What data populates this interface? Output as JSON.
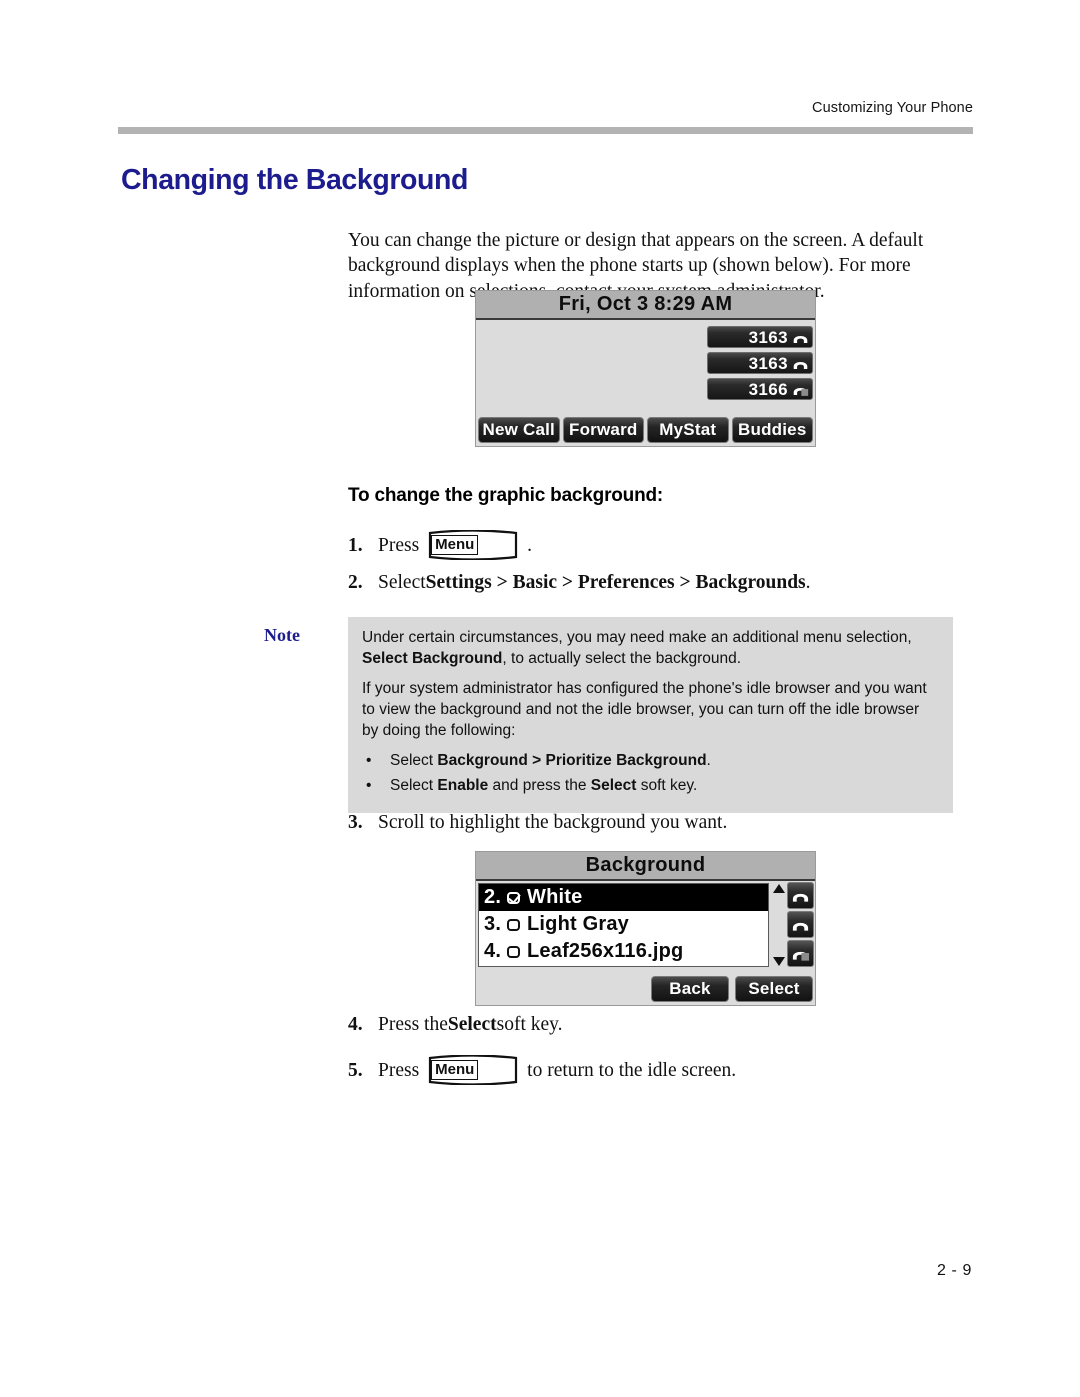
{
  "header": {
    "running_head": "Customizing Your Phone"
  },
  "heading": {
    "title": "Changing the Background",
    "color": "#1c1c8f"
  },
  "intro": {
    "paragraph": "You can change the picture or design that appears on the screen. A default background displays when the phone starts up (shown below). For more information on selections, contact your system administrator."
  },
  "idle_screen": {
    "title": "Fri, Oct 3   8:29 AM",
    "line_keys": [
      {
        "label": "3163",
        "icon": "handset-icon"
      },
      {
        "label": "3163",
        "icon": "handset-icon"
      },
      {
        "label": "3166",
        "icon": "handset-icon"
      }
    ],
    "soft_keys": [
      "New Call",
      "Forward",
      "MyStat",
      "Buddies"
    ]
  },
  "procedure": {
    "subhead": "To change the graphic background:",
    "steps": [
      {
        "num": "1.",
        "pre": "Press",
        "key": "Menu",
        "post": "."
      },
      {
        "num": "2.",
        "text_plain": "Select ",
        "text_bold": "Settings > Basic > Preferences > Backgrounds",
        "text_tail": "."
      }
    ],
    "step3": {
      "num": "3.",
      "text": "Scroll to highlight the background you want."
    },
    "step4": {
      "num": "4.",
      "pre": "Press the ",
      "bold": "Select",
      "post": " soft key."
    },
    "step5": {
      "num": "5.",
      "pre": "Press",
      "key": "Menu",
      "post": "to return to the idle screen."
    }
  },
  "note": {
    "label": "Note",
    "para1_a": "Under certain circumstances, you may need make an additional menu selection, ",
    "para1_b": "Select Background",
    "para1_c": ", to actually select the background.",
    "para2": "If your system administrator has configured the phone's idle browser and you want to view the background and not the idle browser, you can turn off the idle browser by doing the following:",
    "bullet1_a": "Select ",
    "bullet1_b": "Background > Prioritize Background",
    "bullet1_c": ".",
    "bullet2_a": "Select ",
    "bullet2_b": "Enable",
    "bullet2_c": " and press the ",
    "bullet2_d": "Select",
    "bullet2_e": " soft key.",
    "bullet_glyph": "•",
    "background_color": "#d9d9d9"
  },
  "background_screen": {
    "title": "Background",
    "rows": [
      {
        "index": "2.",
        "label": "White",
        "checked": true,
        "selected": true
      },
      {
        "index": "3.",
        "label": "Light Gray",
        "checked": false,
        "selected": false
      },
      {
        "index": "4.",
        "label": "Leaf256x116.jpg",
        "checked": false,
        "selected": false
      }
    ],
    "scroll_up_icon": "arrow-up-icon",
    "scroll_down_icon": "arrow-down-icon",
    "line_key_icons": [
      "handset-icon",
      "handset-icon",
      "handset-icon"
    ],
    "soft_keys": [
      "Back",
      "Select"
    ]
  },
  "footer": {
    "page_number": "2 - 9"
  }
}
